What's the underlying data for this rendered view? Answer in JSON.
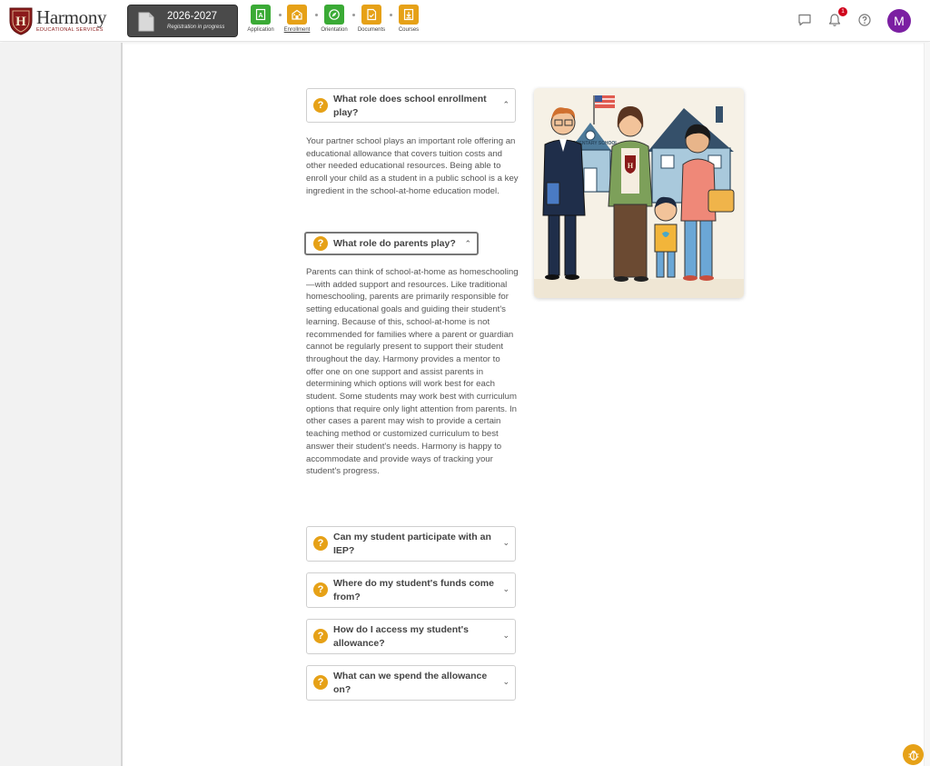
{
  "brand": {
    "name": "Harmony",
    "subtitle": "EDUCATIONAL SERVICES",
    "shield_letter": "H",
    "color": "#8a1a1a"
  },
  "school_year": {
    "year": "2026-2027",
    "status": "Registration in progress"
  },
  "steps": [
    {
      "label": "Application",
      "color": "#3aaa35",
      "icon": "application-icon",
      "active": false
    },
    {
      "label": "Enrollment",
      "color": "#e6a117",
      "icon": "enrollment-icon",
      "active": true
    },
    {
      "label": "Orientation",
      "color": "#3aaa35",
      "icon": "compass-icon",
      "active": false
    },
    {
      "label": "Documents",
      "color": "#e6a117",
      "icon": "documents-icon",
      "active": false
    },
    {
      "label": "Courses",
      "color": "#e6a117",
      "icon": "courses-icon",
      "active": false
    }
  ],
  "header": {
    "notification_count": "1",
    "avatar_initial": "M"
  },
  "faq": {
    "icon_glyph": "?",
    "items": [
      {
        "question": "What role does school enrollment play?",
        "expanded": true,
        "answer": "Your partner school plays an important role offering an educational allowance that covers tuition costs and other needed educational resources.  Being able to enroll your child as a student in a public school is a key ingredient in the school-at-home education model."
      },
      {
        "question": "What role do parents play?",
        "expanded": true,
        "answer": "Parents can think of school-at-home as homeschooling—with added support and resources.  Like traditional homeschooling, parents are primarily responsible for setting educational goals and guiding their student's learning. Because of this, school-at-home is not recommended for families where a parent or guardian cannot be regularly present to support their student throughout the day.  Harmony provides a mentor to offer one on one support and assist parents in determining which options will work best for each student.  Some students may work best with curriculum options that require only light attention from parents.  In other cases a parent may wish to provide a certain teaching method or customized curriculum to best answer their student's needs.  Harmony is happy to accommodate and provide ways of tracking your student's progress."
      },
      {
        "question": "Can my student participate with an IEP?",
        "expanded": false
      },
      {
        "question": "Where do my student's funds come from?",
        "expanded": false
      },
      {
        "question": "How do I access my student's allowance?",
        "expanded": false
      },
      {
        "question": "What can we spend the allowance on?",
        "expanded": false
      }
    ]
  },
  "illustration": {
    "school_sign": "ELEMENTARY SCHOOL",
    "shirt_letter": "H"
  }
}
